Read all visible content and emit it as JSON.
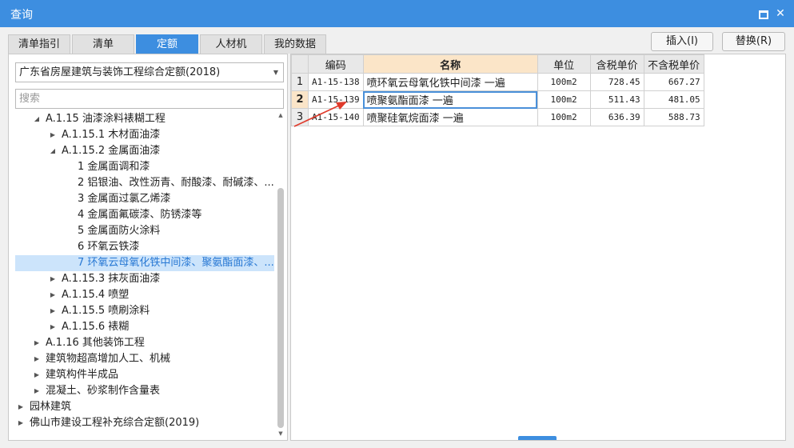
{
  "window": {
    "title": "查询"
  },
  "tabs": [
    {
      "label": "清单指引",
      "active": false
    },
    {
      "label": "清单",
      "active": false
    },
    {
      "label": "定额",
      "active": true
    },
    {
      "label": "人材机",
      "active": false
    },
    {
      "label": "我的数据",
      "active": false
    }
  ],
  "toolbar": {
    "insert_label": "插入(I)",
    "replace_label": "替换(R)"
  },
  "left": {
    "quota_select": "广东省房屋建筑与装饰工程综合定额(2018)",
    "search_placeholder": "搜索",
    "tree": [
      {
        "label": "A.1.15 油漆涂料裱糊工程",
        "level": 1,
        "toggle": "expanded"
      },
      {
        "label": "A.1.15.1 木材面油漆",
        "level": 2,
        "toggle": "collapsed"
      },
      {
        "label": "A.1.15.2 金属面油漆",
        "level": 2,
        "toggle": "expanded"
      },
      {
        "label": "1 金属面调和漆",
        "level": 3,
        "toggle": "none"
      },
      {
        "label": "2 铝银油、改性沥青、耐酸漆、耐碱漆、...",
        "level": 3,
        "toggle": "none"
      },
      {
        "label": "3 金属面过氯乙烯漆",
        "level": 3,
        "toggle": "none"
      },
      {
        "label": "4 金属面氟碳漆、防锈漆等",
        "level": 3,
        "toggle": "none"
      },
      {
        "label": "5 金属面防火涂料",
        "level": 3,
        "toggle": "none"
      },
      {
        "label": "6 环氧云铁漆",
        "level": 3,
        "toggle": "none"
      },
      {
        "label": "7 环氧云母氧化铁中间漆、聚氨酯面漆、...",
        "level": 3,
        "toggle": "none",
        "selected": true
      },
      {
        "label": "A.1.15.3 抹灰面油漆",
        "level": 2,
        "toggle": "collapsed"
      },
      {
        "label": "A.1.15.4 喷塑",
        "level": 2,
        "toggle": "collapsed"
      },
      {
        "label": "A.1.15.5 喷刷涂料",
        "level": 2,
        "toggle": "collapsed"
      },
      {
        "label": "A.1.15.6 裱糊",
        "level": 2,
        "toggle": "collapsed"
      },
      {
        "label": "A.1.16 其他装饰工程",
        "level": 1,
        "toggle": "collapsed"
      },
      {
        "label": "建筑物超高增加人工、机械",
        "level": 1,
        "toggle": "collapsed"
      },
      {
        "label": "建筑构件半成品",
        "level": 1,
        "toggle": "collapsed"
      },
      {
        "label": "混凝土、砂浆制作含量表",
        "level": 1,
        "toggle": "collapsed"
      },
      {
        "label": "园林建筑",
        "level": 0,
        "toggle": "collapsed"
      },
      {
        "label": "佛山市建设工程补充综合定额(2019)",
        "level": 0,
        "toggle": "collapsed"
      }
    ]
  },
  "grid": {
    "headers": [
      "",
      "编码",
      "名称",
      "单位",
      "含税单价",
      "不含税单价"
    ],
    "rows": [
      {
        "num": "1",
        "code": "A1-15-138",
        "name": "喷环氧云母氧化铁中间漆 一遍",
        "unit": "100m2",
        "price_tax": "728.45",
        "price_notax": "667.27"
      },
      {
        "num": "2",
        "code": "A1-15-139",
        "name": "喷聚氨酯面漆 一遍",
        "unit": "100m2",
        "price_tax": "511.43",
        "price_notax": "481.05"
      },
      {
        "num": "3",
        "code": "A1-15-140",
        "name": "喷聚硅氧烷面漆 一遍",
        "unit": "100m2",
        "price_tax": "636.39",
        "price_notax": "588.73"
      }
    ]
  },
  "icons": {
    "maximize": "maximize-icon",
    "close": "close-icon",
    "dropdown": "chevron-down-icon",
    "expanded": "triangle-down-icon",
    "collapsed": "triangle-right-icon"
  },
  "colors": {
    "accent": "#3d8ee0",
    "selected_bg": "#cce4fb",
    "header_highlight": "#fbe5c8",
    "annotation_arrow": "#e03a2b"
  }
}
